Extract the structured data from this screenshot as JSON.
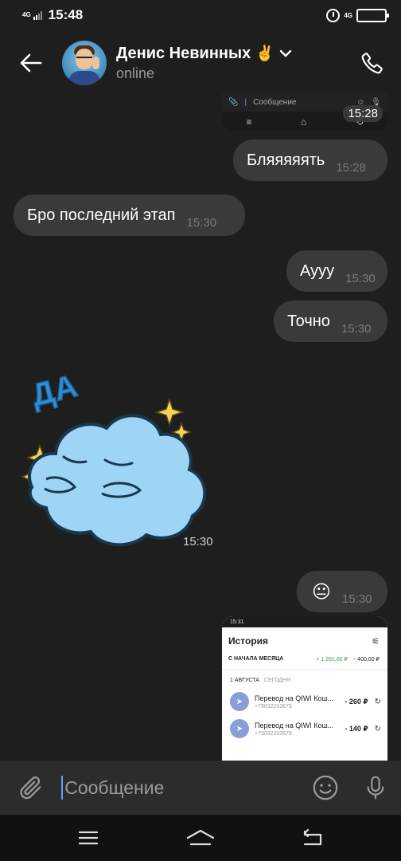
{
  "status_bar": {
    "network": "4G",
    "time": "15:48",
    "network2": "4G",
    "battery": "80",
    "battery_level": 0.8
  },
  "header": {
    "contact_name": "Денис Невинных",
    "emoji": "✌️",
    "status": "online"
  },
  "messages": {
    "screenshot_top": {
      "input_placeholder": "Сообщение",
      "time": "15:28"
    },
    "m1": {
      "text": "Бляяяяять",
      "time": "15:28"
    },
    "m2": {
      "text": "Бро последний этап",
      "time": "15:30"
    },
    "m3": {
      "text": "Аууу",
      "time": "15:30"
    },
    "m4": {
      "text": "Точно",
      "time": "15:30"
    },
    "sticker": {
      "word": "ДА",
      "time": "15:30"
    },
    "m5": {
      "emoji": "😐",
      "time": "15:30"
    },
    "screenshot_bottom": {
      "status_time": "15:31",
      "title": "История",
      "month_label": "С НАЧАЛА МЕСЯЦА",
      "income": "+ 1 261,00 ₽",
      "outcome": "- 400,00 ₽",
      "date_label": "1 АВГУСТА",
      "date_sub": "СЕГОДНЯ",
      "transactions": [
        {
          "name": "Перевод на QIWI Кош...",
          "phone": "+79032203678",
          "amount": "- 260 ₽"
        },
        {
          "name": "Перевод на QIWI Кош...",
          "phone": "+79032203678",
          "amount": "- 140 ₽"
        }
      ]
    }
  },
  "composer": {
    "placeholder": "Сообщение"
  },
  "colors": {
    "background": "#1e1e1e",
    "bubble": "#3a3a3a",
    "cursor": "#5aa0ff",
    "battery": "#f7c61f"
  }
}
